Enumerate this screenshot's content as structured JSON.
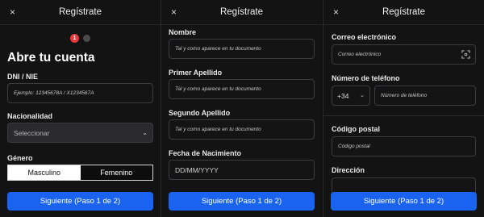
{
  "panel1": {
    "title": "Regístrate",
    "close": "×",
    "step_current": "1",
    "heading": "Abre tu cuenta",
    "dni_label": "DNI / NIE",
    "dni_placeholder": "Ejemplo: 12345678A / X1234567A",
    "nationality_label": "Nacionalidad",
    "nationality_value": "Seleccionar",
    "gender_label": "Género",
    "gender_options": [
      "Masculino",
      "Femenino"
    ],
    "next_button": "Siguiente (Paso 1 de 2)"
  },
  "panel2": {
    "title": "Regístrate",
    "close": "×",
    "fields": [
      {
        "label": "Nombre",
        "placeholder": "Tal y como aparece en tu documento"
      },
      {
        "label": "Primer Apellido",
        "placeholder": "Tal y como aparece en tu documento"
      },
      {
        "label": "Segundo Apellido",
        "placeholder": "Tal y como aparece en tu documento"
      },
      {
        "label": "Fecha de Nacimiento",
        "placeholder": "DD/MM/YYYY"
      }
    ],
    "next_button": "Siguiente (Paso 1 de 2)"
  },
  "panel3": {
    "title": "Regístrate",
    "close": "×",
    "email_label": "Correo electrónico",
    "email_placeholder": "Correo electrónico",
    "phone_label": "Número de teléfono",
    "phone_prefix": "+34",
    "phone_placeholder": "Número de teléfono",
    "postal_label": "Código postal",
    "postal_placeholder": "Código postal",
    "address_label": "Dirección",
    "next_button": "Siguiente (Paso 1 de 2)"
  },
  "colors": {
    "background": "#131314",
    "primary_button": "#1a63f0",
    "step_active": "#e5383b",
    "step_inactive": "#4a4a4d"
  }
}
